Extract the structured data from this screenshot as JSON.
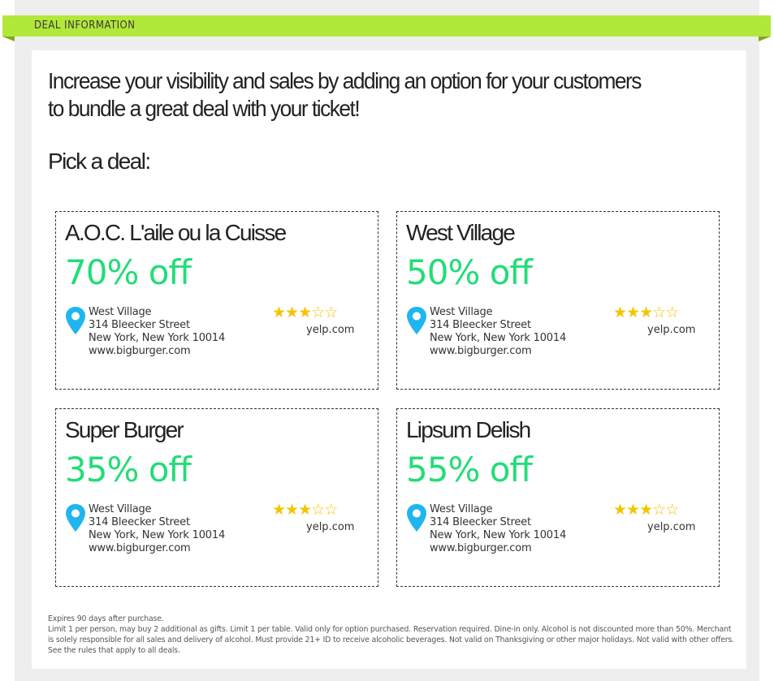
{
  "section": {
    "title": "DEAL INFORMATION",
    "accent_color": "#b1e83a"
  },
  "intro": "Increase your visibility and sales by adding an option for your customers to bundle a great deal with your ticket!",
  "pick_label": "Pick a deal:",
  "deals": [
    {
      "name": "A.O.C. L'aile ou la Cuisse",
      "discount": "70% off",
      "address": [
        "West Village",
        "314 Bleecker Street",
        "New York, New York 10014",
        "www.bigburger.com"
      ],
      "rating": 3,
      "rating_max": 5,
      "source": "yelp.com"
    },
    {
      "name": "West Village",
      "discount": "50% off",
      "address": [
        "West Village",
        "314 Bleecker Street",
        "New York, New York 10014",
        "www.bigburger.com"
      ],
      "rating": 3,
      "rating_max": 5,
      "source": "yelp.com"
    },
    {
      "name": "Super Burger",
      "discount": "35% off",
      "address": [
        "West Village",
        "314 Bleecker Street",
        "New York, New York 10014",
        "www.bigburger.com"
      ],
      "rating": 3,
      "rating_max": 5,
      "source": "yelp.com"
    },
    {
      "name": "Lipsum Delish",
      "discount": "55% off",
      "address": [
        "West Village",
        "314 Bleecker Street",
        "New York, New York 10014",
        "www.bigburger.com"
      ],
      "rating": 3,
      "rating_max": 5,
      "source": "yelp.com"
    }
  ],
  "fine_print": {
    "expiry": "Expires 90 days after purchase.",
    "terms": "Limit 1 per person, may buy 2 additional as gifts. Limit 1 per table. Valid only for option purchased. Reservation required. Dine-in only. Alcohol is not discounted more than 50%. Merchant is solely responsible for all sales and delivery of alcohol. Must provide 21+ ID to receive alcoholic beverages. Not valid on Thanksgiving or other major holidays. Not valid with other offers. See the rules that apply to all deals."
  },
  "colors": {
    "discount": "#22dd77",
    "pin": "#1fb6f0",
    "star": "#f5c400"
  },
  "icons": {
    "pin": "location-pin-icon",
    "star_filled": "star-filled-icon",
    "star_empty": "star-empty-icon"
  }
}
